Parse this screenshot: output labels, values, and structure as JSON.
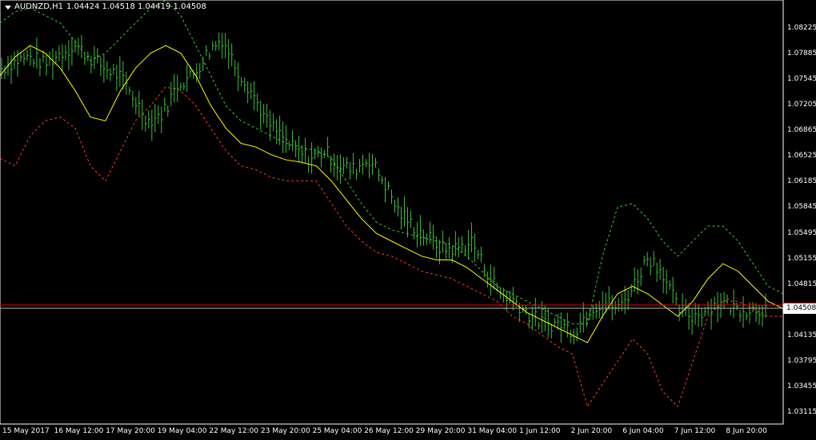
{
  "window": {
    "symbol_label": "AUDNZD,H1",
    "ohlc": "1.04424 1.04518 1.04419 1.04508"
  },
  "colors": {
    "background": "#000000",
    "bars": "#3fbf3f",
    "ma_line": "#ffff00",
    "upper_band": "#33cc33",
    "lower_band": "#ff3b1f",
    "alert_line": "#ff0000",
    "bid_line": "#b4b4b4",
    "axis": "#ffffff"
  },
  "price_axis": {
    "ticks": [
      "1.08225",
      "1.07885",
      "1.07545",
      "1.07205",
      "1.06865",
      "1.06525",
      "1.06185",
      "1.05845",
      "1.05495",
      "1.05155",
      "1.04815",
      "1.04135",
      "1.03795",
      "1.03455",
      "1.03115"
    ],
    "current_price": "1.04508",
    "range": [
      1.03,
      1.085
    ]
  },
  "time_axis": {
    "ticks": [
      "15 May 2017",
      "16 May 12:00",
      "17 May 20:00",
      "19 May 04:00",
      "22 May 12:00",
      "23 May 20:00",
      "25 May 04:00",
      "26 May 12:00",
      "29 May 20:00",
      "31 May 04:00",
      "1 Jun 12:00",
      "2 Jun 20:00",
      "6 Jun 04:00",
      "7 Jun 12:00",
      "8 Jun 20:00"
    ]
  },
  "chart_data": {
    "type": "line",
    "title": "AUDNZD,H1",
    "series": [
      {
        "values": [
          1.077,
          1.078,
          1.0785,
          1.0775,
          1.079,
          1.08,
          1.0785,
          1.077,
          1.076,
          1.073,
          1.07,
          1.071,
          1.075,
          1.076,
          1.079,
          1.081,
          1.077,
          1.074,
          1.07,
          1.068,
          1.066,
          1.065,
          1.066,
          1.064,
          1.0635,
          1.065,
          1.062,
          1.058,
          1.056,
          1.0545,
          1.053,
          1.053,
          1.054,
          1.05,
          1.047,
          1.046,
          1.044,
          1.043,
          1.043,
          1.042,
          1.045,
          1.046,
          1.045,
          1.048,
          1.052,
          1.05,
          1.045,
          1.044,
          1.045,
          1.046,
          1.045,
          1.045,
          1.045
        ]
      },
      {
        "values": [
          1.076,
          1.0785,
          1.08,
          1.079,
          1.077,
          1.074,
          1.0705,
          1.07,
          1.074,
          1.077,
          1.079,
          1.08,
          1.079,
          1.076,
          1.072,
          1.069,
          1.067,
          1.0665,
          1.0655,
          1.0648,
          1.0645,
          1.064,
          1.062,
          1.0595,
          1.057,
          1.055,
          1.054,
          1.053,
          1.052,
          1.0515,
          1.0515,
          1.0505,
          1.049,
          1.0475,
          1.046,
          1.0445,
          1.0435,
          1.0425,
          1.0415,
          1.0405,
          1.044,
          1.047,
          1.048,
          1.047,
          1.0455,
          1.044,
          1.046,
          1.049,
          1.051,
          1.05,
          1.048,
          1.046,
          1.045
        ]
      },
      {
        "values": [
          1.083,
          1.0845,
          1.085,
          1.084,
          1.083,
          1.0805,
          1.078,
          1.079,
          1.081,
          1.083,
          1.085,
          1.086,
          1.084,
          1.08,
          1.076,
          1.072,
          1.07,
          1.069,
          1.068,
          1.067,
          1.0665,
          1.066,
          1.065,
          1.062,
          1.059,
          1.0565,
          1.0555,
          1.055,
          1.0545,
          1.054,
          1.0535,
          1.052,
          1.05,
          1.048,
          1.047,
          1.046,
          1.045,
          1.044,
          1.043,
          1.043,
          1.052,
          1.0585,
          1.059,
          1.057,
          1.054,
          1.052,
          1.054,
          1.056,
          1.056,
          1.054,
          1.051,
          1.048,
          1.047
        ]
      },
      {
        "values": [
          1.065,
          1.064,
          1.068,
          1.07,
          1.0705,
          1.069,
          1.064,
          1.062,
          1.066,
          1.07,
          1.072,
          1.0745,
          1.074,
          1.072,
          1.069,
          1.066,
          1.064,
          1.0635,
          1.0625,
          1.062,
          1.062,
          1.062,
          1.059,
          1.056,
          1.054,
          1.0525,
          1.052,
          1.051,
          1.05,
          1.0495,
          1.049,
          1.048,
          1.047,
          1.046,
          1.044,
          1.043,
          1.0415,
          1.04,
          1.039,
          1.032,
          1.035,
          1.038,
          1.041,
          1.039,
          1.034,
          1.032,
          1.038,
          1.044,
          1.046,
          1.046,
          1.045,
          1.044,
          1.044
        ]
      }
    ],
    "alert_level": 1.0455,
    "bid_level": 1.04508,
    "ylim": [
      1.03,
      1.085
    ]
  }
}
